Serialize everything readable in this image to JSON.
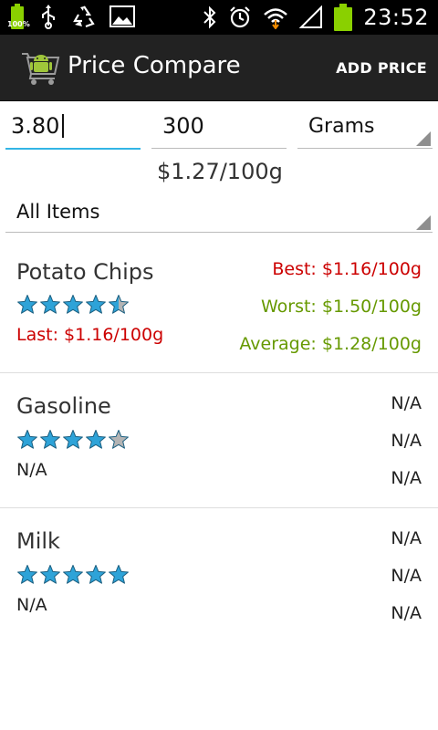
{
  "status_bar": {
    "battery_small_label": "100%",
    "time": "23:52",
    "icons": [
      "battery-icon",
      "usb-icon",
      "recycle-icon",
      "image-icon",
      "bluetooth-icon",
      "alarm-icon",
      "wifi-icon",
      "signal-icon",
      "battery-icon"
    ]
  },
  "action_bar": {
    "title": "Price Compare",
    "action_label": "ADD PRICE"
  },
  "entry": {
    "price_value": "3.80",
    "quantity_value": "300",
    "unit_selected": "Grams",
    "computed_unit_price": "$1.27/100g"
  },
  "filter": {
    "selected": "All Items"
  },
  "items": [
    {
      "name": "Potato Chips",
      "rating": 4.5,
      "last": "Last: $1.16/100g",
      "best": "Best: $1.16/100g",
      "worst": "Worst: $1.50/100g",
      "average": "Average: $1.28/100g"
    },
    {
      "name": "Gasoline",
      "rating": 4,
      "last": "N/A",
      "best": "N/A",
      "worst": "N/A",
      "average": "N/A"
    },
    {
      "name": "Milk",
      "rating": 5,
      "last": "N/A",
      "best": "N/A",
      "worst": "N/A",
      "average": "N/A"
    }
  ],
  "colors": {
    "accent": "#33b5e5",
    "star_fill": "#2ea3d8",
    "star_empty": "#b4b4b4",
    "best_red": "#cc0000",
    "worst_green": "#669900",
    "action_bar": "#222222"
  }
}
